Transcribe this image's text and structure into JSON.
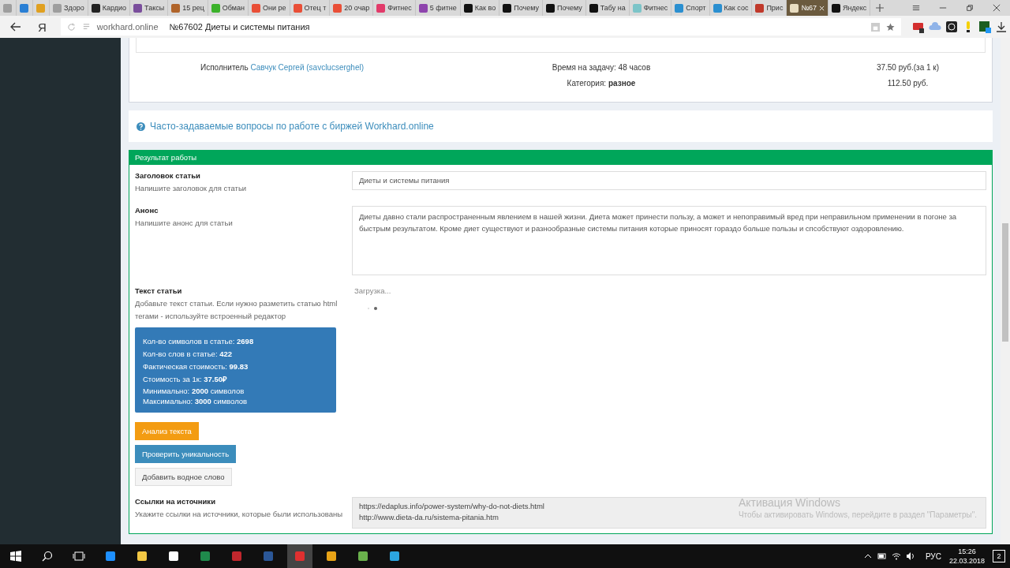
{
  "browser": {
    "tabs": [
      {
        "color": "#9e9e9e",
        "selected": false
      },
      {
        "color": "#2a7fd4",
        "selected": false
      },
      {
        "color": "#e0a020",
        "selected": false
      },
      {
        "title": "Здоро",
        "color": "#9e9e9e",
        "selected": false
      },
      {
        "title": "Кардио",
        "color": "#222222",
        "selected": false
      },
      {
        "title": "Таксы",
        "color": "#7a4e9c",
        "selected": false
      },
      {
        "title": "15 рец",
        "color": "#b0642a",
        "selected": false
      },
      {
        "title": "Обман",
        "color": "#3cb22b",
        "selected": false
      },
      {
        "title": "Они ре",
        "color": "#e94f37",
        "selected": false
      },
      {
        "title": "Отец т",
        "color": "#e94f37",
        "selected": false
      },
      {
        "title": "20 очар",
        "color": "#e94f37",
        "selected": false
      },
      {
        "title": "Фитнес",
        "color": "#e23b6a",
        "selected": false
      },
      {
        "title": "5 фитне",
        "color": "#8e44ad",
        "selected": false
      },
      {
        "title": "Как во",
        "color": "#111111",
        "selected": false
      },
      {
        "title": "Почему",
        "color": "#111111",
        "selected": false
      },
      {
        "title": "Почему",
        "color": "#111111",
        "selected": false
      },
      {
        "title": "Табу на",
        "color": "#111111",
        "selected": false
      },
      {
        "title": "Фитнес",
        "color": "#7cc4c8",
        "selected": false
      },
      {
        "title": "Спорт",
        "color": "#2a8fd0",
        "selected": false
      },
      {
        "title": "Как сос",
        "color": "#2a8fd0",
        "selected": false
      },
      {
        "title": "Прис",
        "color": "#c0392b",
        "selected": false
      },
      {
        "title": "№67",
        "color": "#e8dcc0",
        "selected": true
      },
      {
        "title": "Яндекс",
        "color": "#111111",
        "selected": false
      }
    ],
    "logo": "Я",
    "domain": "workhard.online",
    "page_title": "№67602 Диеты и системы питания"
  },
  "task_info": {
    "executor_label": "Исполнитель",
    "executor_link": "Савчук Сергей (savclucserghel)",
    "time": "Время на задачу: 48 часов",
    "category": "Категория: **разное**",
    "price_per_k": "37.50 руб.(за 1 к)",
    "total": "112.50 руб."
  },
  "faq_link": "Часто-задаваемые вопросы по работе с биржей Workhard.online",
  "result": {
    "header": "Результат работы",
    "fields": [
      {
        "kind": "input",
        "label": "Заголовок статьи",
        "hint": "Напишите заголовок для статьи",
        "value": "Диеты и системы питания"
      },
      {
        "kind": "textarea",
        "label": "Анонс",
        "hint": "Напишите анонс для статьи",
        "value": "Диеты давно стали распространенным явлением в нашей жизни. Диета может принести пользу, а может и непоправимый вред при неправильном применении в погоне за быстрым результатом. Кроме диет существуют и разнообразные системы питания которые приносят гораздо больше пользы и спсобствуют оздоровлению."
      },
      {
        "kind": "editor",
        "label": "Текст статьи",
        "hint": "Добавьте текст статьи. Если нужно разметить статью html тегами - используйте встроенный редактор",
        "value": "Загрузка..."
      },
      {
        "kind": "links",
        "label": "Ссылки на источники",
        "hint": "Укажите ссылки на источники, которые были использованы",
        "value": "https://edaplus.info/power-system/why-do-not-diets.html\nhttp://www.dieta-da.ru/sistema-pitania.htm"
      }
    ],
    "stats": [
      "Кол-во символов в статье: **2698**",
      "Кол-во слов в статье: **422**",
      "Фактическая стоимость: **99.83**",
      "Стоимость за 1к: **37.50₽**",
      "Минимально: **2000** символов",
      "Максимально: **3000** символов"
    ],
    "buttons": [
      {
        "kind": "warning",
        "label": "Анализ текста"
      },
      {
        "kind": "primary",
        "label": "Проверить уникальность"
      },
      {
        "kind": "default",
        "label": "Добавить водное слово"
      }
    ]
  },
  "activation": {
    "title": "Активация Windows",
    "subtitle": "Чтобы активировать Windows, перейдите в раздел \"Параметры\"."
  },
  "taskbar": {
    "language": "РУС",
    "time": "15:26",
    "date": "22.03.2018",
    "notifications": "2"
  }
}
